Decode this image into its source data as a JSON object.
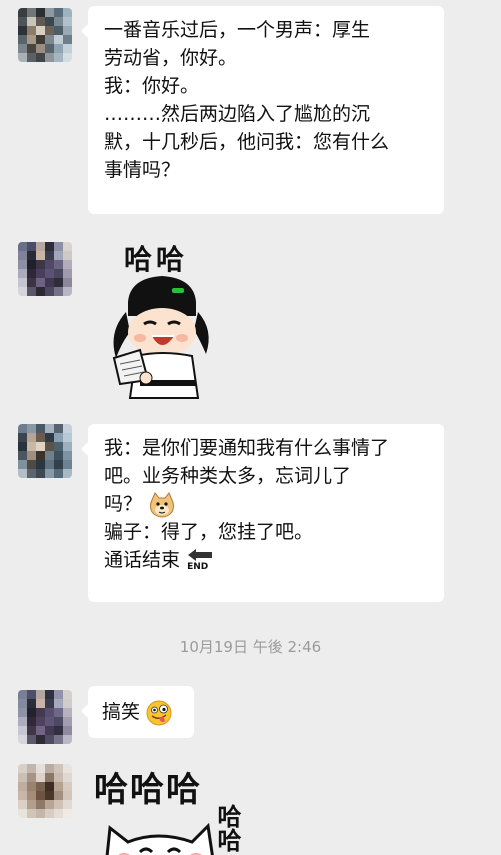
{
  "messages": [
    {
      "lines": [
        "一番音乐过后，一个男声：厚生",
        "劳动省，你好。",
        "我：你好。",
        "………然后两边陷入了尴尬的沉",
        "默，十几秒后，他问我：您有什么",
        "事情吗？"
      ]
    },
    {
      "sticker_text": "哈哈"
    },
    {
      "lines": [
        "我：是你们要通知我有什么事情了",
        "吧。业务种类太多，忘词儿了",
        "吗？",
        "骗子：得了，您挂了吧。",
        "通话结束"
      ],
      "end_icon_label": "END"
    },
    {
      "text": "搞笑"
    },
    {
      "sticker_text_top": "哈哈哈",
      "sticker_text_side": "哈哈"
    }
  ],
  "timestamp": "10月19日 午後 2:46",
  "icons": {
    "doge": "doge-emoji-icon",
    "end_arrow": "end-arrow-icon",
    "silly": "silly-face-emoji-icon"
  },
  "colors": {
    "background": "#ededed",
    "bubble": "#ffffff",
    "timestamp": "#9b9b9b"
  }
}
